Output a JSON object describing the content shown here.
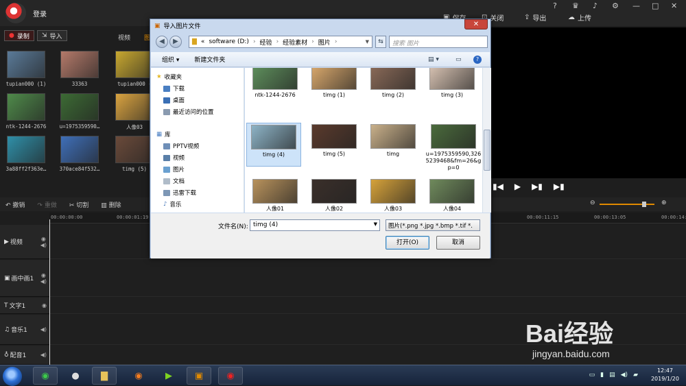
{
  "app": {
    "login_label": "登录",
    "save_label": "保存",
    "close_label": "关闭",
    "export_label": "导出",
    "upload_label": "上传",
    "window_controls": [
      "?",
      "—",
      "□",
      "✕"
    ]
  },
  "left_panel": {
    "record_label": "录制",
    "import_label": "导入",
    "tab_video": "视频",
    "tab_image": "图",
    "thumbs": [
      {
        "caption": "tupian000 (1)",
        "color": "#5a7a98"
      },
      {
        "caption": "33363",
        "color": "#b47a6a"
      },
      {
        "caption": "tupian000 (",
        "color": "#c8a830"
      },
      {
        "caption": "ntk-1244-2676",
        "color": "#4f8a4a"
      },
      {
        "caption": "u=1975359590…",
        "color": "#3c6a34"
      },
      {
        "caption": "人像03",
        "color": "#d9a340"
      },
      {
        "caption": "3a88ff2f363e…",
        "color": "#2f8fa8"
      },
      {
        "caption": "370ace84f532…",
        "color": "#3f6fb8"
      },
      {
        "caption": "timg (5)",
        "color": "#6a4a3a"
      }
    ]
  },
  "toolbar": {
    "undo": "撤销",
    "redo": "重做",
    "cut": "切割",
    "delete": "删除"
  },
  "ruler": [
    "00:00:00:00",
    "00:00:01:19",
    "00:00:11:15",
    "00:00:13:05",
    "00:00:14:2"
  ],
  "tracks": [
    "视频",
    "画中画1",
    "文字1",
    "音乐1",
    "配音1"
  ],
  "dialog": {
    "title": "导入图片文件",
    "close": "✕",
    "path": [
      "«",
      "software (D:)",
      "经验",
      "经验素材",
      "图片"
    ],
    "search_placeholder": "搜索 图片",
    "organize": "组织 ▾",
    "new_folder": "新建文件夹",
    "nav": {
      "favorites": "收藏夹",
      "downloads": "下载",
      "desktop": "桌面",
      "recent": "最近访问的位置",
      "libraries": "库",
      "pptv": "PPTV视频",
      "videos": "视频",
      "pictures": "图片",
      "documents": "文档",
      "thunder": "迅雷下载",
      "music": "音乐"
    },
    "files": [
      {
        "name": "ntk-1244-2676",
        "color": "#5e8f5c"
      },
      {
        "name": "timg (1)",
        "color": "#d9a86c"
      },
      {
        "name": "timg (2)",
        "color": "#8a6a58"
      },
      {
        "name": "timg (3)",
        "color": "#d7c2b2"
      },
      {
        "name": "timg (4)",
        "color": "#8db3c6"
      },
      {
        "name": "timg (5)",
        "color": "#5a3a2c"
      },
      {
        "name": "timg",
        "color": "#c9b08a"
      },
      {
        "name": "u=1975359590,3265239468&fm=26&gp=0",
        "color": "#4a6a3c"
      },
      {
        "name": "人像01",
        "color": "#b8925c"
      },
      {
        "name": "人像02",
        "color": "#3a2f2a"
      },
      {
        "name": "人像03",
        "color": "#d6a23a"
      },
      {
        "name": "人像04",
        "color": "#6f8a5c"
      }
    ],
    "filename_label": "文件名(N):",
    "filename_value": "timg (4)",
    "filetype": "图片(*.png *.jpg *.bmp *.tif *.",
    "open": "打开(O)",
    "cancel": "取消"
  },
  "taskbar": {
    "time": "12:47",
    "date": "2019/1/20"
  },
  "watermark": {
    "brand": "Bai经验",
    "url": "jingyan.baidu.com"
  }
}
